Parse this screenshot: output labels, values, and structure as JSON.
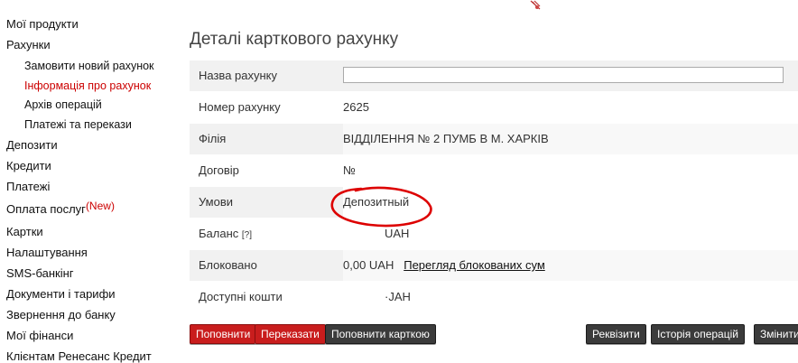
{
  "sidebar": {
    "items": [
      {
        "label": "Мої продукти"
      },
      {
        "label": "Рахунки"
      },
      {
        "label": "Замовити новий рахунок"
      },
      {
        "label": "Інформація про рахунок"
      },
      {
        "label": "Архів операцій"
      },
      {
        "label": "Платежі та перекази"
      },
      {
        "label": "Депозити"
      },
      {
        "label": "Кредити"
      },
      {
        "label": "Платежі"
      },
      {
        "label": "Оплата послуг",
        "badge": "(New)"
      },
      {
        "label": "Картки"
      },
      {
        "label": "Налаштування"
      },
      {
        "label": "SMS-банкінг"
      },
      {
        "label": "Документи і тарифи"
      },
      {
        "label": "Звернення до банку"
      },
      {
        "label": "Мої фінанси"
      },
      {
        "label": "Клієнтам Ренесанс Кредит"
      }
    ]
  },
  "main": {
    "title": "Деталі карткового рахунку",
    "rows": {
      "name": {
        "label": "Назва рахунку",
        "value": ""
      },
      "number": {
        "label": "Номер рахунку",
        "value": "2625"
      },
      "branch": {
        "label": "Філія",
        "value": "ВІДДІЛЕННЯ № 2 ПУМБ В М. ХАРКІВ"
      },
      "contract": {
        "label": "Договір",
        "value": "№"
      },
      "terms": {
        "label": "Умови",
        "value": "Депозитный"
      },
      "balance": {
        "label": "Баланс",
        "help": "[?]",
        "value": "UAH"
      },
      "blocked": {
        "label": "Блоковано",
        "value": "0,00 UAH",
        "link": "Перегляд блокованих сум"
      },
      "available": {
        "label": "Доступні кошти",
        "value": "·JAH"
      }
    }
  },
  "buttons": {
    "topup": "Поповнити",
    "transfer": "Переказати",
    "topup_card": "Поповнити карткою",
    "details": "Реквізити",
    "history": "Історія операцій",
    "change": "Змінити"
  },
  "colors": {
    "accent": "#cc0000",
    "button_dark": "#3b3b3b",
    "button_red": "#c91d1d"
  }
}
